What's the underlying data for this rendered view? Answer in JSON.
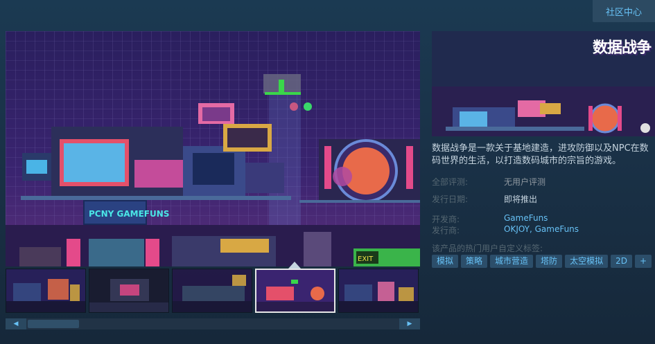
{
  "header": {
    "community_label": "社区中心"
  },
  "game": {
    "logo_text": "数据战争",
    "description": "数据战争是一款关于基地建造，进攻防御以及NPC在数码世界的生活，以打造数码城市的宗旨的游戏。"
  },
  "details": {
    "reviews_label": "全部评测:",
    "reviews_value": "无用户评测",
    "release_label": "发行日期:",
    "release_value": "即将推出",
    "developer_label": "开发商:",
    "developer_value": "GameFuns",
    "publisher_label": "发行商:",
    "publisher_value": "OKJOY, GameFuns"
  },
  "tags": {
    "label": "该产品的热门用户自定义标签:",
    "items": [
      "模拟",
      "策略",
      "城市营造",
      "塔防",
      "太空模拟",
      "2D",
      "+"
    ]
  },
  "screenshot": {
    "sign_text": "PCNY GAMEFUNS",
    "sign_exit": "EXIT"
  },
  "scrollbar": {
    "left_arrow": "◀",
    "right_arrow": "▶"
  },
  "colors": {
    "accent": "#67c1f5",
    "tag_bg": "#2c4e6a"
  }
}
